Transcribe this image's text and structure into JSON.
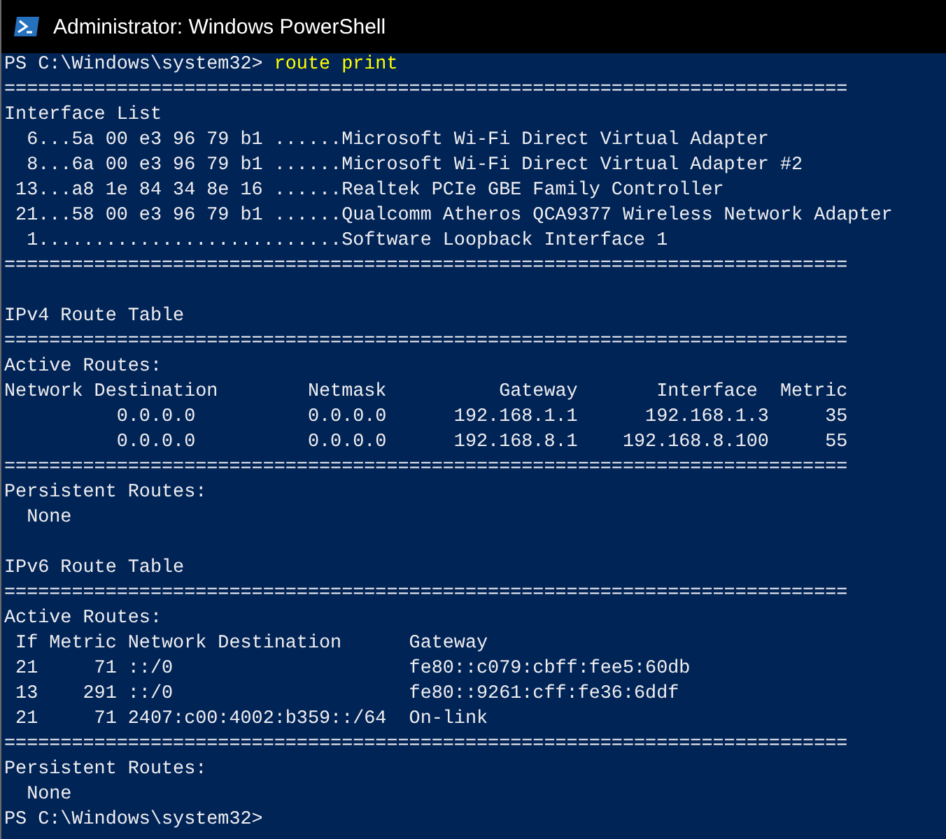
{
  "window": {
    "title": "Administrator: Windows PowerShell"
  },
  "console": {
    "lines": [
      {
        "kind": "prompt",
        "prompt": "PS C:\\Windows\\system32>",
        "command": "route print"
      },
      {
        "kind": "rule",
        "text": "==========================================================================="
      },
      {
        "kind": "text",
        "text": "Interface List"
      },
      {
        "kind": "text",
        "text": "  6...5a 00 e3 96 79 b1 ......Microsoft Wi-Fi Direct Virtual Adapter"
      },
      {
        "kind": "text",
        "text": "  8...6a 00 e3 96 79 b1 ......Microsoft Wi-Fi Direct Virtual Adapter #2"
      },
      {
        "kind": "text",
        "text": " 13...a8 1e 84 34 8e 16 ......Realtek PCIe GBE Family Controller"
      },
      {
        "kind": "text",
        "text": " 21...58 00 e3 96 79 b1 ......Qualcomm Atheros QCA9377 Wireless Network Adapter"
      },
      {
        "kind": "text",
        "text": "  1...........................Software Loopback Interface 1"
      },
      {
        "kind": "rule",
        "text": "==========================================================================="
      },
      {
        "kind": "blank"
      },
      {
        "kind": "text",
        "text": "IPv4 Route Table"
      },
      {
        "kind": "rule",
        "text": "==========================================================================="
      },
      {
        "kind": "text",
        "text": "Active Routes:"
      },
      {
        "kind": "text",
        "text": "Network Destination        Netmask          Gateway       Interface  Metric"
      },
      {
        "kind": "text",
        "text": "          0.0.0.0          0.0.0.0      192.168.1.1      192.168.1.3     35"
      },
      {
        "kind": "text",
        "text": "          0.0.0.0          0.0.0.0      192.168.8.1    192.168.8.100     55"
      },
      {
        "kind": "rule",
        "text": "==========================================================================="
      },
      {
        "kind": "text",
        "text": "Persistent Routes:"
      },
      {
        "kind": "text",
        "text": "  None"
      },
      {
        "kind": "blank"
      },
      {
        "kind": "text",
        "text": "IPv6 Route Table"
      },
      {
        "kind": "rule",
        "text": "==========================================================================="
      },
      {
        "kind": "text",
        "text": "Active Routes:"
      },
      {
        "kind": "text",
        "text": " If Metric Network Destination      Gateway"
      },
      {
        "kind": "text",
        "text": " 21     71 ::/0                     fe80::c079:cbff:fee5:60db"
      },
      {
        "kind": "text",
        "text": " 13    291 ::/0                     fe80::9261:cff:fe36:6ddf"
      },
      {
        "kind": "text",
        "text": " 21     71 2407:c00:4002:b359::/64  On-link"
      },
      {
        "kind": "rule",
        "text": "==========================================================================="
      },
      {
        "kind": "text",
        "text": "Persistent Routes:"
      },
      {
        "kind": "text",
        "text": "  None"
      },
      {
        "kind": "prompt",
        "prompt": "PS C:\\Windows\\system32>"
      }
    ]
  }
}
